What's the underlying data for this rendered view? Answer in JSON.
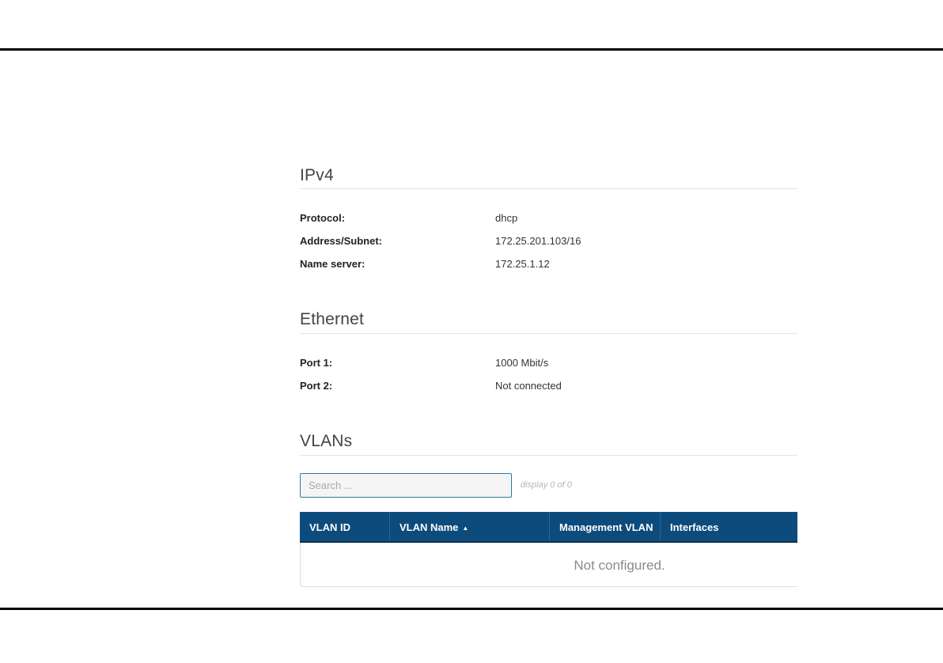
{
  "ipv4": {
    "title": "IPv4",
    "rows": [
      {
        "label": "Protocol:",
        "value": "dhcp"
      },
      {
        "label": "Address/Subnet:",
        "value": "172.25.201.103/16"
      },
      {
        "label": "Name server:",
        "value": "172.25.1.12"
      }
    ]
  },
  "ethernet": {
    "title": "Ethernet",
    "rows": [
      {
        "label": "Port 1:",
        "value": "1000 Mbit/s"
      },
      {
        "label": "Port 2:",
        "value": "Not connected"
      }
    ]
  },
  "vlans": {
    "title": "VLANs",
    "search": {
      "placeholder": "Search ...",
      "value": ""
    },
    "display_count": "display 0 of 0",
    "columns": [
      "VLAN ID",
      "VLAN Name",
      "Management VLAN",
      "Interfaces"
    ],
    "sort_column": "VLAN Name",
    "sort_direction": "ascending",
    "empty_message": "Not configured."
  },
  "colors": {
    "table_header": "#0d4b7c",
    "search_border": "#2c79a8"
  }
}
